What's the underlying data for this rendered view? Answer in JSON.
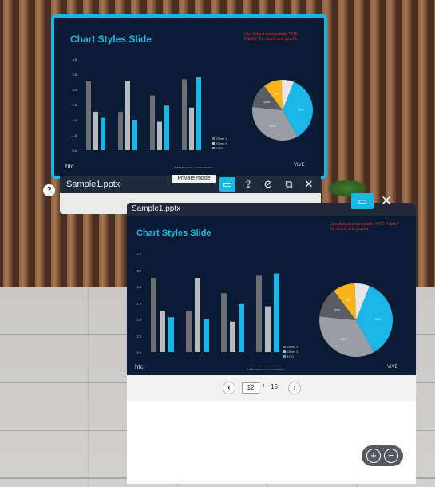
{
  "colors": {
    "accent": "#1ab6e8",
    "slide_bg": "#0a1c33",
    "bar_other1": "#6d6f73",
    "bar_other2": "#b9bbbd",
    "bar_htc": "#1ab6e8",
    "pie_blue": "#1ab6e8",
    "pie_gray": "#9a9da1",
    "pie_dark": "#5a5e63",
    "pie_orange": "#f7b519",
    "pie_white": "#e6e6e6"
  },
  "back_window": {
    "filename": "Sample1.pptx",
    "private_mode_label": "Private mode",
    "help_label": "?",
    "toolbar_icons": [
      "screen-icon",
      "upload-icon",
      "hide-eye-icon",
      "window-resize-icon",
      "close-icon"
    ],
    "icon_glyphs": [
      "▭",
      "⇪",
      "⊘",
      "⧉",
      "✕"
    ]
  },
  "front_window": {
    "filename": "Sample1.pptx",
    "share_icon_glyph": "▭",
    "close_glyph": "✕",
    "pager": {
      "prev_glyph": "‹",
      "next_glyph": "›",
      "current_page": "12",
      "separator": "/",
      "total_pages": "15"
    },
    "zoom": {
      "zoom_in_glyph": "+",
      "zoom_out_glyph": "−"
    }
  },
  "slide": {
    "title": "Chart Styles Slide",
    "note": "Use default color palette \"HTC Palette\" for charts and graphs",
    "brand_left": "htc",
    "brand_right": "VIVE",
    "footer": "© HTC Proprietary and Confidential"
  },
  "chart_data": [
    {
      "type": "bar",
      "categories": [
        "1",
        "2",
        "3",
        "4"
      ],
      "ylim": [
        0,
        4.5
      ],
      "yticks": [
        "0.0",
        "1.5",
        "2.0",
        "2.5",
        "3.0",
        "3.5",
        "4.5"
      ],
      "series": [
        {
          "name": "Other 1",
          "values": [
            3.4,
            1.9,
            2.7,
            3.5
          ]
        },
        {
          "name": "Other 2",
          "values": [
            1.9,
            3.4,
            1.4,
            2.1
          ]
        },
        {
          "name": "HTC",
          "values": [
            1.6,
            1.5,
            2.2,
            3.6
          ]
        }
      ],
      "legend": "right"
    },
    {
      "type": "pie",
      "slices": [
        {
          "label": "33%",
          "value": 33
        },
        {
          "label": "32%",
          "value": 32
        },
        {
          "label": "12%",
          "value": 12
        },
        {
          "label": "9%",
          "value": 9
        },
        {
          "label": "6%",
          "value": 6
        }
      ]
    }
  ]
}
